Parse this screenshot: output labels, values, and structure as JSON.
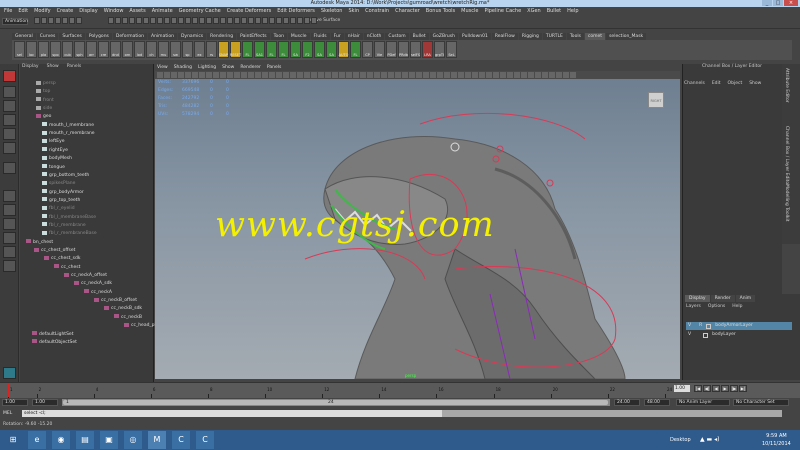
{
  "app": {
    "title": "Autodesk Maya 2014: D:\\Work\\Projects\\gumroad\\wretch\\wretchRig.ma*",
    "window_buttons": [
      "_",
      "□",
      "×"
    ]
  },
  "menubar": [
    "File",
    "Edit",
    "Modify",
    "Create",
    "Display",
    "Window",
    "Assets",
    "Animate",
    "Geometry Cache",
    "Create Deformers",
    "Edit Deformers",
    "Skeleton",
    "Skin",
    "Constrain",
    "Character",
    "Bonus Tools",
    "Muscle",
    "Pipeline Cache",
    "XGen",
    "Bullet",
    "Help"
  ],
  "status": {
    "mode": "Animation",
    "live_surface": "No Live Surface"
  },
  "shelf": {
    "tabs": [
      "General",
      "Curves",
      "Surfaces",
      "Polygons",
      "Deformation",
      "Animation",
      "Dynamics",
      "Rendering",
      "PaintEffects",
      "Toon",
      "Muscle",
      "Fluids",
      "Fur",
      "nHair",
      "nCloth",
      "Custom",
      "Bullet",
      "GoZBrush",
      "Pulldown01",
      "RealFlow",
      "Rigging",
      "TURTLE",
      "Tools",
      "comet",
      "selection_Mask"
    ],
    "active_tab": "comet",
    "buttons": [
      "sel",
      "loc",
      "pla",
      "spo",
      "cub",
      "sph",
      "arr",
      "cre",
      "dnd",
      "orn",
      "lod",
      "ch",
      "mu",
      "sw",
      "sp",
      "ex",
      "rs",
      "SNAP",
      "RESET",
      "FL",
      "SA1",
      "FL",
      "FL",
      "SA",
      "F2",
      "SA",
      "SA",
      "AUTO",
      "FL",
      "CP",
      "Vie",
      "PDef",
      "PRdb",
      "selFS",
      "LRA",
      "grpTI",
      "SeL"
    ]
  },
  "outliner": {
    "menu": [
      "Display",
      "Show",
      "Panels"
    ],
    "items": [
      {
        "label": "persp",
        "dim": true
      },
      {
        "label": "top",
        "dim": true
      },
      {
        "label": "front",
        "dim": true
      },
      {
        "label": "side",
        "dim": true
      },
      {
        "label": "geo",
        "dim": false
      },
      {
        "label": "mouth_l_membrane",
        "dim": false
      },
      {
        "label": "mouth_r_membrane",
        "dim": false
      },
      {
        "label": "leftEye",
        "dim": false
      },
      {
        "label": "rightEye",
        "dim": false
      },
      {
        "label": "bodyMesh",
        "dim": false
      },
      {
        "label": "tongue",
        "dim": false
      },
      {
        "label": "grp_bottom_teeth",
        "dim": false
      },
      {
        "label": "spikesPlane",
        "dim": true
      },
      {
        "label": "grp_bodyArmor",
        "dim": false
      },
      {
        "label": "grp_top_teeth",
        "dim": false
      },
      {
        "label": "fbl_r_eyelid",
        "dim": true
      },
      {
        "label": "fbl_l_membraneBase",
        "dim": true
      },
      {
        "label": "fbl_r_membrane",
        "dim": true
      },
      {
        "label": "fbl_r_membraneBase",
        "dim": true
      },
      {
        "label": "bn_chest",
        "dim": false
      },
      {
        "label": "cc_chest_offset",
        "dim": false
      },
      {
        "label": "cc_chest_sdk",
        "dim": false
      },
      {
        "label": "cc_chest",
        "dim": false
      },
      {
        "label": "cc_neckA_offset",
        "dim": false
      },
      {
        "label": "cc_neckA_sdk",
        "dim": false
      },
      {
        "label": "cc_neckA",
        "dim": false
      },
      {
        "label": "cc_neckB_offset",
        "dim": false
      },
      {
        "label": "cc_neckB_sdk",
        "dim": false
      },
      {
        "label": "cc_neckB",
        "dim": false
      },
      {
        "label": "cc_head_pl",
        "dim": false
      },
      {
        "label": "defaultLightSet",
        "dim": false
      },
      {
        "label": "defaultObjectSet",
        "dim": false
      }
    ]
  },
  "viewport": {
    "menu": [
      "View",
      "Shading",
      "Lighting",
      "Show",
      "Renderer",
      "Panels"
    ],
    "hud": [
      {
        "k": "Verts:",
        "v": "337696",
        "a": "0",
        "b": "0"
      },
      {
        "k": "Edges:",
        "v": "669548",
        "a": "0",
        "b": "0"
      },
      {
        "k": "Faces:",
        "v": "242792",
        "a": "0",
        "b": "0"
      },
      {
        "k": "Tris:",
        "v": "484282",
        "a": "0",
        "b": "0"
      },
      {
        "k": "UVs:",
        "v": "578294",
        "a": "0",
        "b": "0"
      }
    ],
    "viewcube_label": "RIGHT",
    "camera": "persp",
    "watermark": "www.cgtsj.com"
  },
  "channelbox": {
    "title": "Channel Box / Layer Editor",
    "menu": [
      "Channels",
      "Edit",
      "Object",
      "Show"
    ],
    "side_tabs": [
      "Attribute Editor",
      "Channel Box / Layer Editor",
      "Modelling Toolkit"
    ]
  },
  "layers": {
    "tabs": [
      "Display",
      "Render",
      "Anim"
    ],
    "active_tab": "Display",
    "menu": [
      "Layers",
      "Options",
      "Help"
    ],
    "items": [
      {
        "v": "V",
        "p": "",
        "r": "R",
        "name": "bodyArmorLayer",
        "selected": true
      },
      {
        "v": "V",
        "p": "",
        "r": "",
        "name": "bodyLayer",
        "selected": false
      }
    ]
  },
  "timeline": {
    "ticks": [
      "1",
      "2",
      "4",
      "6",
      "8",
      "10",
      "12",
      "14",
      "16",
      "18",
      "20",
      "22",
      "24"
    ],
    "current_frame": "1.00",
    "play_buttons": [
      "|◀",
      "◀|",
      "◀",
      "▶",
      "|▶",
      "▶|"
    ]
  },
  "range": {
    "start": "1.00",
    "inner_start": "1.00",
    "inner_label": "1",
    "handle_end": "24",
    "end_inner": "24.00",
    "end": "48.00",
    "anim_layer": "No Anim Layer",
    "char_set": "No Character Set"
  },
  "cmdline": {
    "label": "MEL",
    "value": "select -cl;"
  },
  "helpline": "Rotation: -9.60 -15.20",
  "taskbar": {
    "desktop": "Desktop",
    "time": "9:59 AM",
    "date": "10/11/2014"
  }
}
